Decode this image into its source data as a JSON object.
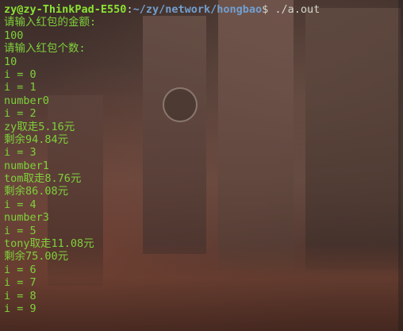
{
  "prompt": {
    "user_host": "zy@zy-ThinkPad-E550",
    "separator": ":",
    "path": "~/zy/network/hongbao",
    "symbol": "$",
    "command": " ./a.out"
  },
  "output_lines": [
    "请输入红包的金额:",
    "100",
    "请输入红包个数:",
    "10",
    "i = 0",
    "i = 1",
    "number0",
    "i = 2",
    "zy取走5.16元",
    "剩余94.84元",
    "i = 3",
    "number1",
    "tom取走8.76元",
    "剩余86.08元",
    "i = 4",
    "number3",
    "i = 5",
    "tony取走11.08元",
    "剩余75.00元",
    "i = 6",
    "i = 7",
    "i = 8",
    "i = 9"
  ],
  "colors": {
    "output_text": "#7fd13b",
    "prompt_user": "#8ae234",
    "prompt_path": "#729fcf"
  }
}
